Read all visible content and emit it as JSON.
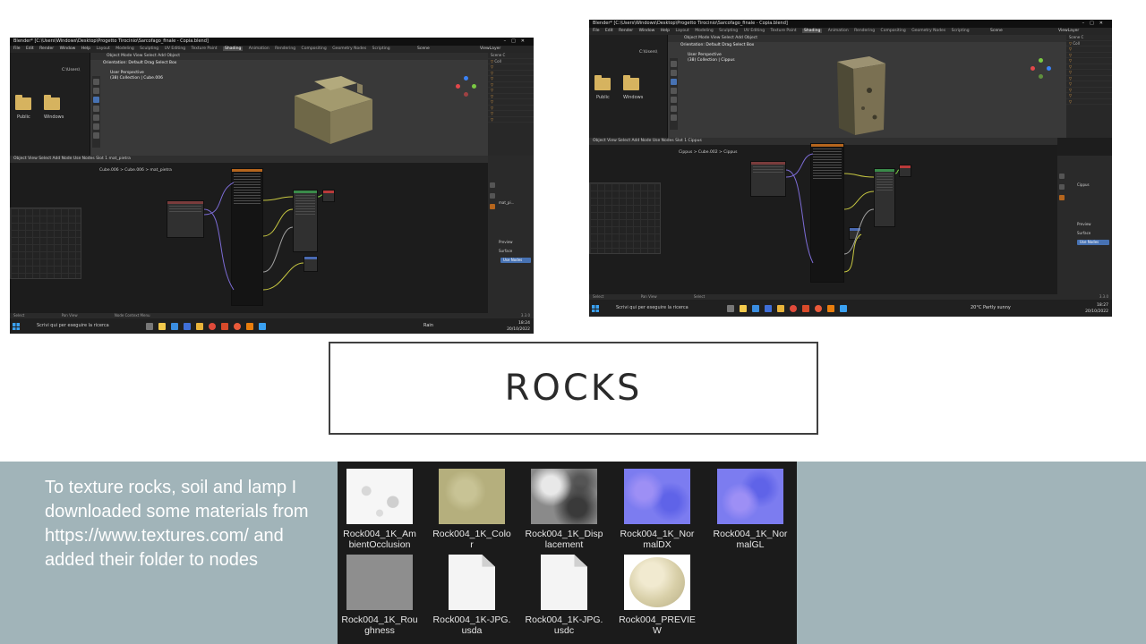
{
  "slide": {
    "title": "ROCKS",
    "description": "To texture rocks, soil and lamp I downloaded some materials from https://www.textures.com/ and added their folder to nodes"
  },
  "screenshot_left": {
    "window_title": "Blender* [C:\\Users\\Windows\\Desktop\\Progetto Tirocinio\\Sarcofago_finale - Copia.blend]",
    "menus": [
      "File",
      "Edit",
      "Render",
      "Window",
      "Help"
    ],
    "workspaces": [
      "Layout",
      "Modeling",
      "Sculpting",
      "UV Editing",
      "Texture Paint",
      "Shading",
      "Animation",
      "Rendering",
      "Compositing",
      "Geometry Nodes",
      "Scripting"
    ],
    "active_workspace": "Shading",
    "scene": "Scene",
    "view_layer": "ViewLayer",
    "file_path": "C:\\Users\\",
    "folders": [
      "Public",
      "Windows"
    ],
    "viewport_header": "Object Mode   View  Select  Add  Object",
    "orientation": "Orientation:  Default    Drag  Select Box",
    "viewport_info_1": "User Perspective",
    "viewport_info_2": "(38) Collection | Cube.006",
    "node_header": "Object   View  Select  Add  Node   Use Nodes     Slot 1     mat_pietra",
    "breadcrumb": "Cube.006  >  Cube.006  >  mat_pietra",
    "material_slot": "mat_pi...",
    "preview": "Preview",
    "surface": "Surface",
    "use_nodes": "Use Nodes",
    "status_left": "Select",
    "status_mid": "Pan View",
    "status_right": "Node Context Menu",
    "version": "3.3.0",
    "taskbar_search": "Scrivi qui per eseguire la ricerca",
    "weather": "Rain",
    "time": "18:24",
    "date": "20/10/2022"
  },
  "screenshot_right": {
    "window_title": "Blender* [C:\\Users\\Windows\\Desktop\\Progetto Tirocinio\\Sarcofago_finale - Copia.blend]",
    "menus": [
      "File",
      "Edit",
      "Render",
      "Window",
      "Help"
    ],
    "workspaces": [
      "Layout",
      "Modeling",
      "Sculpting",
      "UV Editing",
      "Texture Paint",
      "Shading",
      "Animation",
      "Rendering",
      "Compositing",
      "Geometry Nodes",
      "Scripting"
    ],
    "active_workspace": "Shading",
    "scene": "Scene",
    "view_layer": "ViewLayer",
    "file_path": "C:\\Users\\",
    "folders": [
      "Public",
      "Windows"
    ],
    "viewport_header": "Object Mode   View  Select  Add  Object",
    "orientation": "Orientation:  Default    Drag  Select Box",
    "viewport_info_1": "User Perspective",
    "viewport_info_2": "(38) Collection | Cippus",
    "node_header": "Object   View  Select  Add  Node   Use Nodes     Slot 1     Cippus",
    "breadcrumb": "Cippus  >  Cube.002  >  Cippus",
    "material_slot": "Cippus",
    "preview": "Preview",
    "surface": "Surface",
    "use_nodes": "Use Nodes",
    "status_left": "Select",
    "status_mid": "Pan View",
    "status_right": "Select",
    "version": "3.3.0",
    "taskbar_search": "Scrivi qui per eseguire la ricerca",
    "weather": "20°C  Partly sunny",
    "time": "18:27",
    "date": "20/10/2022"
  },
  "files": [
    {
      "name": "Rock004_1K_AmbientOcclusion",
      "label_line1": "Rock004_1K_Am",
      "label_line2": "bientOcclusion",
      "thumb": "ao"
    },
    {
      "name": "Rock004_1K_Color",
      "label_line1": "Rock004_1K_Colo",
      "label_line2": "r",
      "thumb": "color"
    },
    {
      "name": "Rock004_1K_Displacement",
      "label_line1": "Rock004_1K_Disp",
      "label_line2": "lacement",
      "thumb": "disp"
    },
    {
      "name": "Rock004_1K_NormalDX",
      "label_line1": "Rock004_1K_Nor",
      "label_line2": "malDX",
      "thumb": "normal"
    },
    {
      "name": "Rock004_1K_NormalGL",
      "label_line1": "Rock004_1K_Nor",
      "label_line2": "malGL",
      "thumb": "normal"
    },
    {
      "name": "Rock004_1K_Roughness",
      "label_line1": "Rock004_1K_Rou",
      "label_line2": "ghness",
      "thumb": "rough"
    },
    {
      "name": "Rock004_1K-JPG.usda",
      "label_line1": "Rock004_1K-JPG.",
      "label_line2": "usda",
      "thumb": "doc"
    },
    {
      "name": "Rock004_1K-JPG.usdc",
      "label_line1": "Rock004_1K-JPG.",
      "label_line2": "usdc",
      "thumb": "doc"
    },
    {
      "name": "Rock004_PREVIEW",
      "label_line1": "Rock004_PREVIE",
      "label_line2": "W",
      "thumb": "preview"
    }
  ],
  "colors": {
    "band": "#a1b4b9",
    "explorer_bg": "#1b1b1b",
    "blender_accent": "#4772b3"
  }
}
